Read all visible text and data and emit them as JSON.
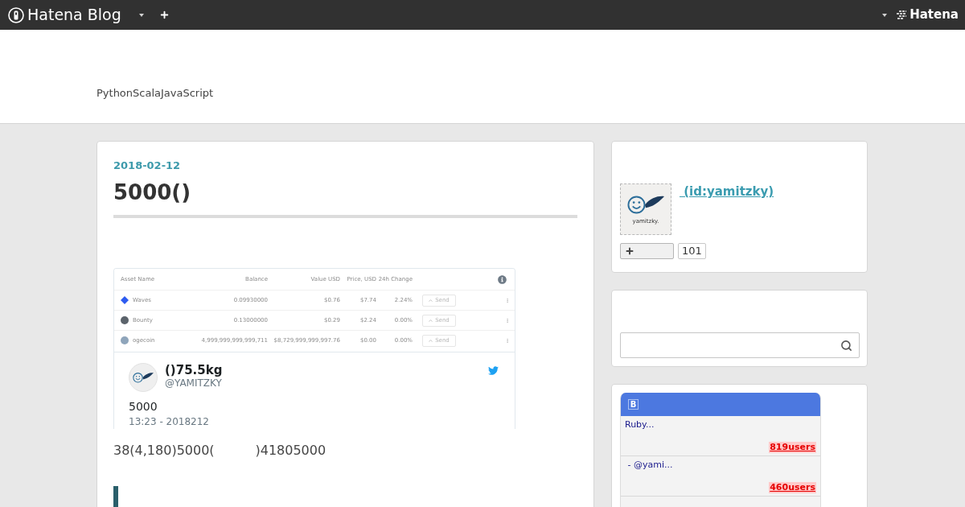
{
  "top_bar": {
    "brand": "Hatena Blog",
    "service_brand": "Hatena"
  },
  "header": {
    "blog_title": "PythonScalaJavaScript"
  },
  "article": {
    "date": "2018-02-12",
    "title": "5000()",
    "tweet": {
      "screenshot": {
        "columns": [
          "Asset Name",
          "Balance",
          "Value USD",
          "Price, USD",
          "24h Change"
        ],
        "rows": [
          {
            "kind": "diamond",
            "color": "#2d5bf0",
            "name": "Waves",
            "balance": "0.09930000",
            "value": "$0.76",
            "price": "$7.74",
            "change": "2.24%",
            "action": "Send"
          },
          {
            "kind": "circle",
            "color": "#5b636b",
            "name": "Bounty",
            "balance": "0.13000000",
            "value": "$0.29",
            "price": "$2.24",
            "change": "0.00%",
            "action": "Send"
          },
          {
            "kind": "circle",
            "color": "#8fa5bb",
            "name": "ogecoin",
            "balance": "4,999,999,999,999,711",
            "value": "$8,729,999,999,997.76",
            "price": "$0.00",
            "change": "0.00%",
            "action": "Send"
          }
        ]
      },
      "author_name": "()75.5kg",
      "handle": "@YAMITZKY",
      "text": "5000",
      "time": "13:23 - 2018212"
    },
    "paragraph": "38(4,180)5000(          )41805000"
  },
  "sidebar": {
    "profile": {
      "avatar_label": "yamitzky.",
      "name_link": " (id:yamitzky)",
      "follower_count": "101"
    },
    "bookmarks": {
      "logo": "B",
      "entries": [
        {
          "title": "Ruby...",
          "users": "819users"
        },
        {
          "title": " - @yami...",
          "users": "460users"
        }
      ]
    }
  }
}
